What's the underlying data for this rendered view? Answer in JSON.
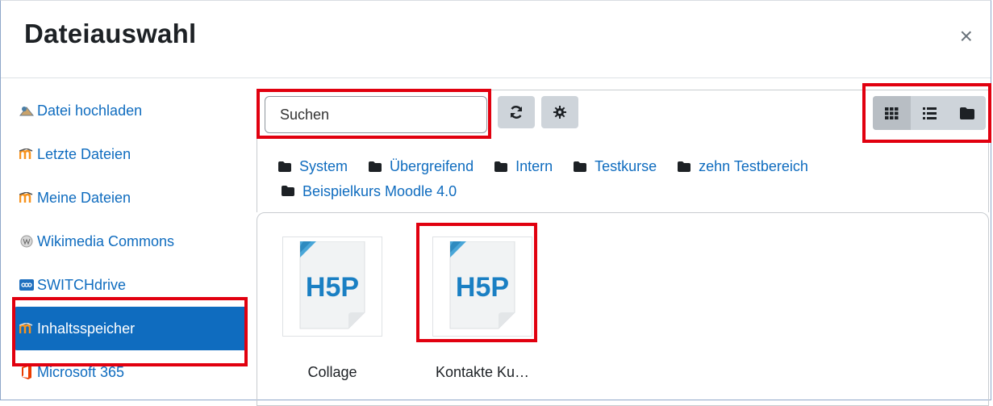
{
  "dialog": {
    "title": "Dateiauswahl",
    "close_label": "×"
  },
  "sidebar": {
    "items": [
      {
        "label": "Datei hochladen",
        "icon": "upload-icon"
      },
      {
        "label": "Letzte Dateien",
        "icon": "moodle-icon"
      },
      {
        "label": "Meine Dateien",
        "icon": "moodle-icon"
      },
      {
        "label": "Wikimedia Commons",
        "icon": "wikipedia-icon"
      },
      {
        "label": "SWITCHdrive",
        "icon": "switchdrive-icon"
      },
      {
        "label": "Inhaltsspeicher",
        "icon": "moodle-icon",
        "active": true
      },
      {
        "label": "Microsoft 365",
        "icon": "office-icon"
      }
    ]
  },
  "toolbar": {
    "search_placeholder": "Suchen",
    "refresh_icon": "refresh-icon",
    "settings_icon": "gear-icon",
    "view_icons": [
      "grid-view-icon",
      "list-view-icon",
      "folder-view-icon"
    ]
  },
  "breadcrumb": [
    "System",
    "Übergreifend",
    "Intern",
    "Testkurse",
    "zehn Testbereich",
    "Beispielkurs Moodle 4.0"
  ],
  "files": [
    {
      "name": "Collage",
      "type": "H5P"
    },
    {
      "name": "Kontakte Ku…",
      "type": "H5P"
    }
  ],
  "colors": {
    "accent": "#0f6cbf",
    "highlight": "#e1000f",
    "button_bg": "#ced4da"
  }
}
